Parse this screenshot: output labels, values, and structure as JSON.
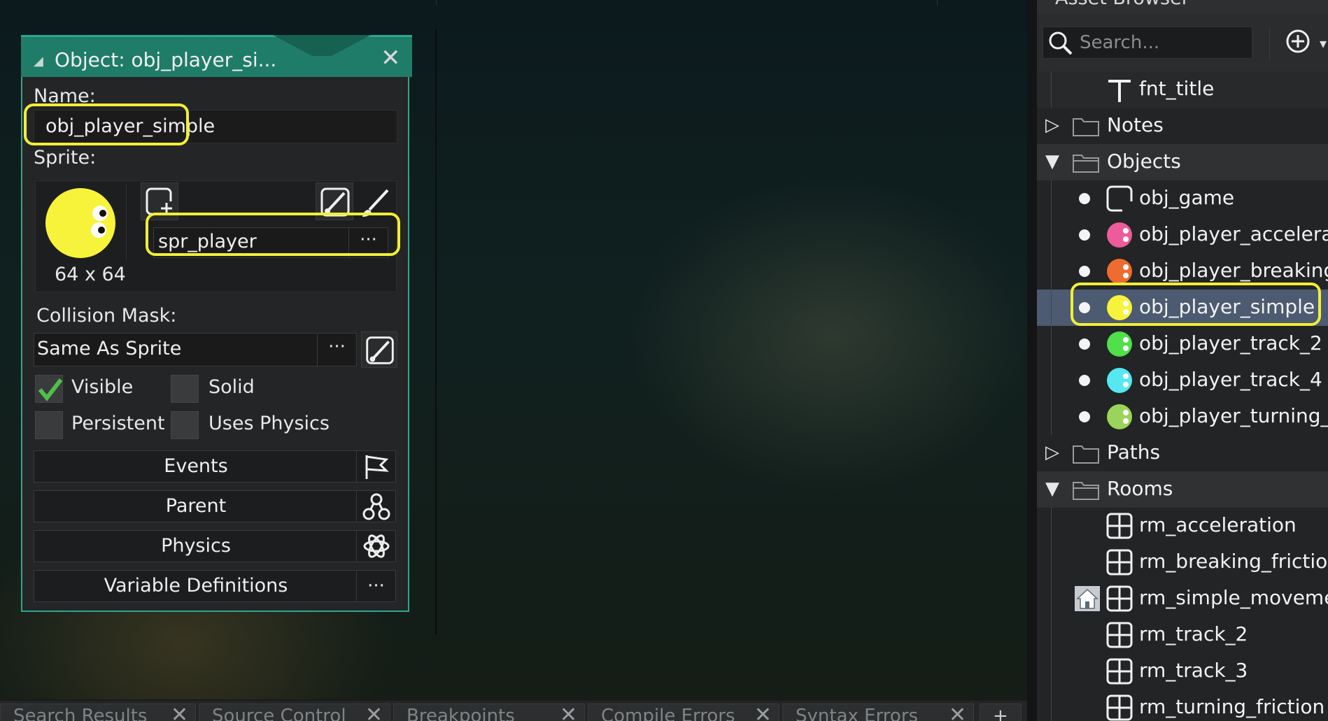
{
  "object_editor": {
    "title": "Object: obj_player_si...",
    "name_label": "Name:",
    "name_value": "obj_player_simple",
    "sprite_label": "Sprite:",
    "sprite_size": "64 x 64",
    "sprite_value": "spr_player",
    "sprite_more": "···",
    "collision_label": "Collision Mask:",
    "collision_value": "Same As Sprite",
    "collision_more": "···",
    "checkboxes": {
      "visible": {
        "label": "Visible",
        "checked": true
      },
      "solid": {
        "label": "Solid",
        "checked": false
      },
      "persistent": {
        "label": "Persistent",
        "checked": false
      },
      "uses_physics": {
        "label": "Uses Physics",
        "checked": false
      }
    },
    "buttons": {
      "events": "Events",
      "parent": "Parent",
      "physics": "Physics",
      "variable_definitions": "Variable Definitions",
      "variable_more": "···"
    }
  },
  "bottom_tabs": [
    "Search Results",
    "Source Control",
    "Breakpoints",
    "Compile Errors",
    "Syntax Errors"
  ],
  "bottom_tab_close": "✕",
  "asset_browser": {
    "title": "Asset Browser",
    "search_placeholder": "Search...",
    "items": {
      "fnt_title": "fnt_title",
      "notes": "Notes",
      "objects": "Objects",
      "obj_game": "obj_game",
      "obj_player_acceleration": "obj_player_accelerati",
      "obj_player_breaking": "obj_player_breaking_",
      "obj_player_simple": "obj_player_simple",
      "obj_player_track_2": "obj_player_track_2",
      "obj_player_track_4": "obj_player_track_4",
      "obj_player_turning": "obj_player_turning_fi",
      "paths": "Paths",
      "rooms": "Rooms",
      "rm_acceleration": "rm_acceleration",
      "rm_breaking_friction": "rm_breaking_friction",
      "rm_simple_movement": "rm_simple_movemen",
      "rm_track_2": "rm_track_2",
      "rm_track_3": "rm_track_3",
      "rm_turning_friction": "rm_turning_friction"
    }
  },
  "colors": {
    "accent": "#2fa58c",
    "highlight": "#f2ee36",
    "selected_row": "#4c5b71",
    "player_simple": "#f7f33a",
    "player_acceleration": "#ee5b9b",
    "player_breaking": "#ef6b2f",
    "player_track_2": "#4fe04a",
    "player_track_4": "#55e8f0",
    "player_turning": "#9bd45a"
  },
  "icons": {
    "title_grip": "grip-icon",
    "close": "close-icon",
    "search": "search-icon",
    "add": "add-circle-icon"
  }
}
